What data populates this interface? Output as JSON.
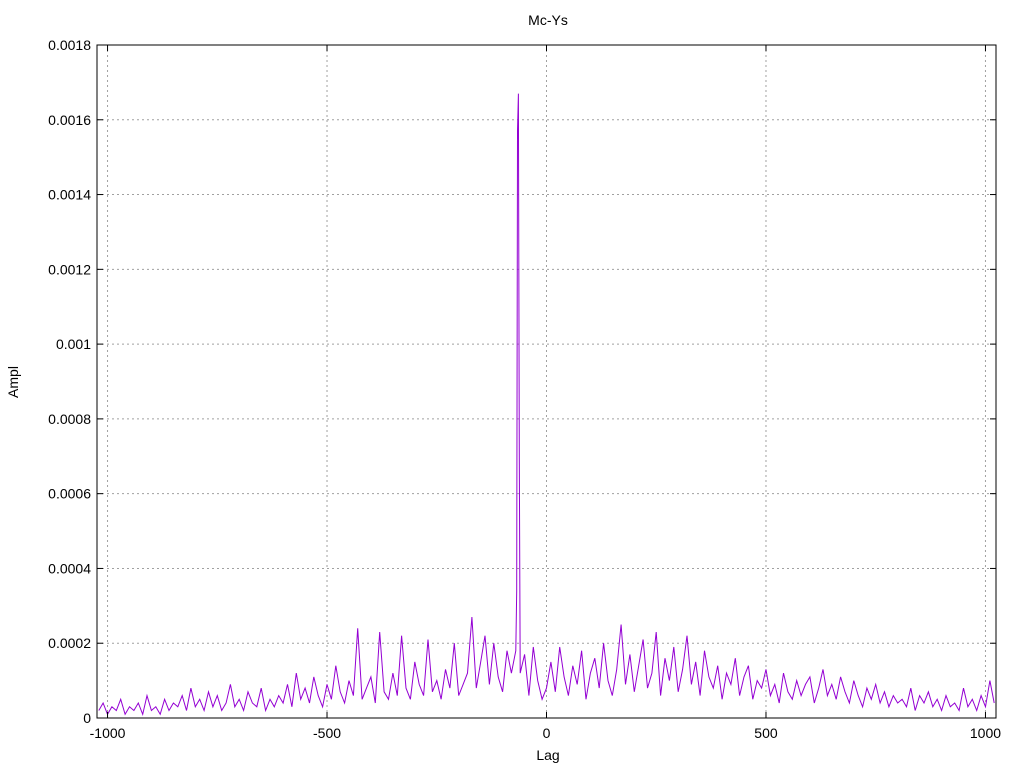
{
  "chart_data": {
    "type": "line",
    "title": "Mc-Ys",
    "xlabel": "Lag",
    "ylabel": "Ampl",
    "xlim": [
      -1024,
      1024
    ],
    "ylim": [
      0,
      0.0018
    ],
    "grid": true,
    "legend": "none",
    "x_ticks": [
      -1000,
      -500,
      0,
      500,
      1000
    ],
    "x_tick_labels": [
      "-1000",
      "-500",
      "0",
      "500",
      "1000"
    ],
    "y_ticks": [
      0,
      0.0002,
      0.0004,
      0.0006,
      0.0008,
      0.001,
      0.0012,
      0.0014,
      0.0016,
      0.0018
    ],
    "y_tick_labels": [
      "0",
      "0.0002",
      "0.0004",
      "0.0006",
      "0.0008",
      "0.001",
      "0.0012",
      "0.0014",
      "0.0016",
      "0.0018"
    ],
    "series": [
      {
        "name": "Mc-Ys",
        "color": "#9400d3",
        "value_unit": 1e-05,
        "x_start": -1020,
        "x_step": 10,
        "values": [
          2,
          4,
          1,
          3,
          2,
          5,
          1,
          3,
          2,
          4,
          1,
          6,
          2,
          3,
          1,
          5,
          2,
          4,
          3,
          6,
          2,
          8,
          3,
          5,
          2,
          7,
          3,
          6,
          2,
          4,
          9,
          3,
          5,
          2,
          7,
          4,
          3,
          8,
          2,
          5,
          3,
          6,
          4,
          9,
          3,
          12,
          5,
          8,
          4,
          11,
          6,
          3,
          9,
          5,
          14,
          7,
          4,
          10,
          6,
          24,
          5,
          8,
          11,
          4,
          23,
          7,
          5,
          12,
          6,
          22,
          8,
          5,
          15,
          9,
          6,
          21,
          7,
          10,
          5,
          13,
          8,
          20,
          6,
          9,
          12,
          27,
          8,
          15,
          22,
          9,
          20,
          11,
          7,
          18,
          12,
          14,
          9,
          17,
          6,
          19,
          10,
          5,
          8,
          15,
          7,
          19,
          11,
          6,
          14,
          9,
          18,
          5,
          12,
          16,
          8,
          20,
          10,
          6,
          13,
          25,
          9,
          17,
          7,
          14,
          21,
          8,
          12,
          23,
          6,
          16,
          10,
          19,
          7,
          13,
          22,
          9,
          15,
          6,
          18,
          11,
          8,
          14,
          5,
          12,
          9,
          16,
          6,
          11,
          14,
          5,
          10,
          8,
          13,
          6,
          9,
          4,
          12,
          7,
          5,
          10,
          6,
          9,
          11,
          4,
          8,
          13,
          6,
          9,
          5,
          11,
          7,
          4,
          10,
          6,
          3,
          8,
          5,
          9,
          4,
          7,
          3,
          6,
          4,
          5,
          3,
          8,
          2,
          6,
          4,
          7,
          3,
          5,
          2,
          6,
          3,
          4,
          2,
          8,
          3,
          5,
          2,
          6,
          3,
          10,
          4
        ],
        "peak_points": [
          [
            -70,
            18
          ],
          [
            -68,
            34
          ],
          [
            -66,
            157
          ],
          [
            -64,
            167
          ],
          [
            -62,
            70
          ],
          [
            -60,
            12
          ]
        ]
      }
    ]
  }
}
